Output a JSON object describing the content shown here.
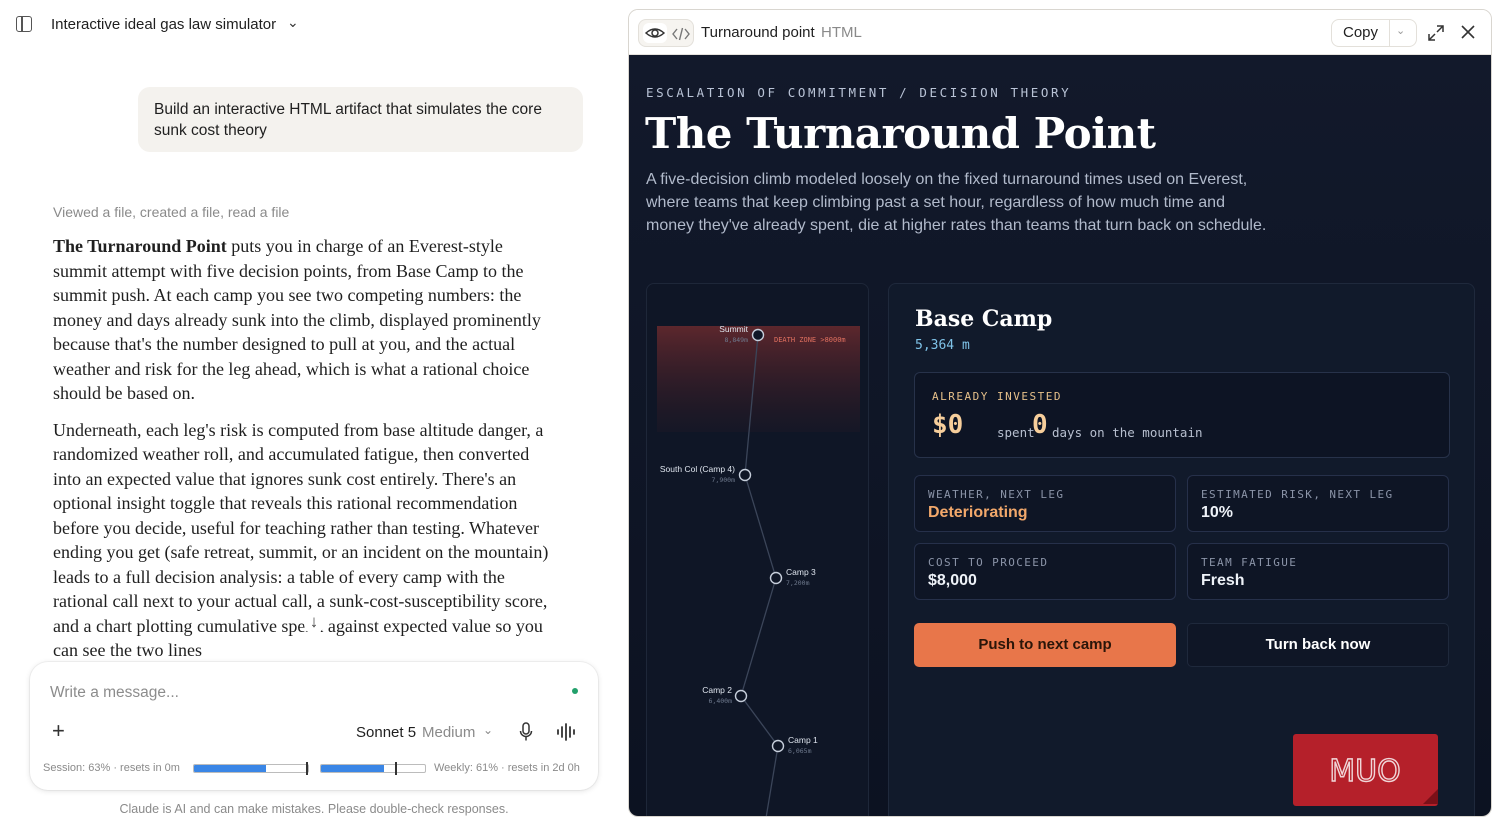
{
  "chat": {
    "title": "Interactive ideal gas law simulator",
    "user_message": "Build an interactive HTML artifact that simulates the core sunk cost theory",
    "tool_summary": "Viewed a file, created a file, read a file",
    "reply": {
      "p1_strong": "The Turnaround Point",
      "p1_rest": " puts you in charge of an Everest-style summit attempt with five decision points, from Base Camp to the summit push. At each camp you see two competing numbers: the money and days already sunk into the climb, displayed prominently because that's the number designed to pull at you, and the actual weather and risk for the leg ahead, which is what a rational choice should be based on.",
      "p2": "Underneath, each leg's risk is computed from base altitude danger, a randomized weather roll, and accumulated fatigue, then converted into an expected value that ignores sunk cost entirely. There's an optional insight toggle that reveals this rational recommendation before you decide, useful for teaching rather than testing. Whatever ending you get (safe retreat, summit, or an incident on the mountain) leads to a full decision analysis: a table of every camp with the rational call next to your actual call, a sunk-cost-susceptibility score, and a chart plotting cumulative spend against expected value so you can see the two lines"
    }
  },
  "composer": {
    "placeholder": "Write a message...",
    "model": "Sonnet 5",
    "effort": "Medium",
    "session_text": "Session: 63% · resets in 0m",
    "session_pct": 63,
    "weekly_text": "Weekly: 61% · resets in 2d 0h",
    "weekly_pct": 61,
    "disclaimer": "Claude is AI and can make mistakes. Please double-check responses."
  },
  "artifact": {
    "title": "Turnaround point",
    "type": "HTML",
    "copy_label": "Copy",
    "eyebrow": "ESCALATION OF COMMITMENT / DECISION THEORY",
    "heading": "The Turnaround Point",
    "intro": "A five-decision climb modeled loosely on the fixed turnaround times used on Everest, where teams that keep climbing past a set hour, regardless of how much time and money they've already spent, die at higher rates than teams that turn back on schedule.",
    "route": {
      "death_zone_label": "DEATH ZONE >8000m",
      "camps": [
        {
          "name": "Summit",
          "alt": "8,849m"
        },
        {
          "name": "South Col (Camp 4)",
          "alt": "7,900m"
        },
        {
          "name": "Camp 3",
          "alt": "7,200m"
        },
        {
          "name": "Camp 2",
          "alt": "6,400m"
        },
        {
          "name": "Camp 1",
          "alt": "6,065m"
        }
      ]
    },
    "camp": {
      "name": "Base Camp",
      "altitude": "5,364 m",
      "invested_label": "ALREADY INVESTED",
      "money": "$0",
      "money_unit": "spent",
      "days": "0",
      "days_unit": "days on the mountain",
      "stats": [
        {
          "label": "WEATHER, NEXT LEG",
          "value": "Deteriorating"
        },
        {
          "label": "ESTIMATED RISK, NEXT LEG",
          "value": "10%"
        },
        {
          "label": "COST TO PROCEED",
          "value": "$8,000"
        },
        {
          "label": "TEAM FATIGUE",
          "value": "Fresh"
        }
      ],
      "push_label": "Push to next camp",
      "turn_label": "Turn back now"
    },
    "watermark": "MUO",
    "colors": {
      "accent": "#e8764a",
      "warning": "#f2a86b",
      "invested": "#f6ce9b",
      "background": "#12192b"
    }
  },
  "icons": [
    "sidebar-toggle-icon",
    "chevron-down-icon",
    "arrow-down-icon",
    "plus-icon",
    "microphone-icon",
    "voice-waveform-icon",
    "eye-icon",
    "code-icon",
    "expand-icon",
    "close-icon"
  ]
}
